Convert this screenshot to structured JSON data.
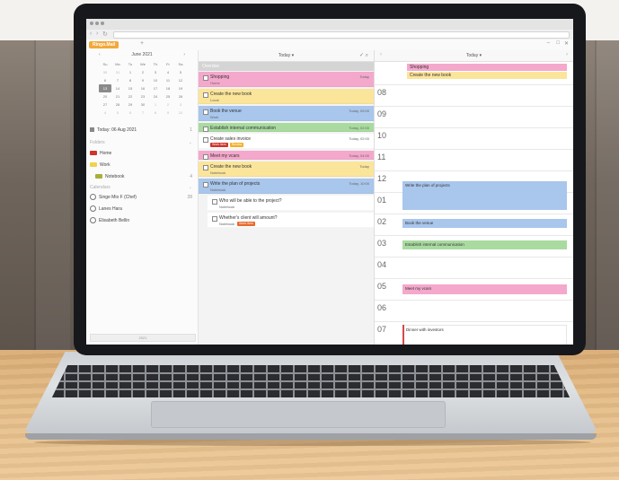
{
  "app": {
    "tab_label": "Ringo.Mail"
  },
  "mini_calendar": {
    "month": "June 2021",
    "weekdays": [
      "Su",
      "Mo",
      "Tu",
      "We",
      "Th",
      "Fr",
      "Sa"
    ],
    "weeks": [
      [
        "30",
        "31",
        "1",
        "2",
        "3",
        "4",
        "5"
      ],
      [
        "6",
        "7",
        "8",
        "9",
        "10",
        "11",
        "12"
      ],
      [
        "13",
        "14",
        "15",
        "16",
        "17",
        "18",
        "19"
      ],
      [
        "20",
        "21",
        "22",
        "23",
        "24",
        "25",
        "26"
      ],
      [
        "27",
        "28",
        "29",
        "30",
        "1",
        "2",
        "3"
      ],
      [
        "4",
        "5",
        "6",
        "7",
        "8",
        "9",
        "10"
      ]
    ]
  },
  "sidebar": {
    "today_label": "Today: 06 Aug 2021",
    "today_count": "1",
    "folders_heading": "Folders",
    "folders": [
      {
        "label": "Home",
        "color": "#d0342c"
      },
      {
        "label": "Work",
        "color": "#f2d24a"
      },
      {
        "label": "Notebook",
        "color": "#a8b03a",
        "count": "4"
      }
    ],
    "calendars_heading": "Calendars",
    "calendars": [
      {
        "label": "Singe Mio F (Chef)",
        "count": "28"
      },
      {
        "label": "Lanes Hara"
      },
      {
        "label": "Elisabeth Bellin"
      }
    ],
    "footer": "2021"
  },
  "tasks": {
    "header_title": "Today ▾",
    "section": "Overdue",
    "items": [
      {
        "title": "Shopping",
        "sub": "Home",
        "meta": "Today",
        "color": "#f4a8cc"
      },
      {
        "title": "Create the new book",
        "sub": "Local",
        "meta": "",
        "color": "#fbe59a"
      },
      {
        "title": "Book the venue",
        "sub": "Work",
        "meta": "Today, 09:00",
        "color": "#a9c6ec"
      },
      {
        "title": "Establish internal communication",
        "sub": "",
        "meta": "Today, 02:00",
        "color": "#a9dba0"
      },
      {
        "title": "Create sales invoice",
        "sub": "",
        "meta": "Today, 02:00",
        "color": "#ffffff",
        "tags": [
          [
            "Work item",
            "#d0342c"
          ],
          [
            "Review",
            "#f2b02a"
          ]
        ]
      },
      {
        "title": "Meet my vcars",
        "sub": "",
        "meta": "Today, 04:00",
        "color": "#f4a8cc"
      },
      {
        "title": "Create the new book",
        "sub": "Notebook",
        "meta": "Today",
        "color": "#fbe59a"
      },
      {
        "title": "Write the plan of projects",
        "sub": "Notebook",
        "meta": "Today, 10:00",
        "color": "#a9c6ec"
      },
      {
        "title": "Who will be able to the project?",
        "sub": "Notebook",
        "meta": "",
        "color": "#ffffff"
      },
      {
        "title": "Whether's client will amount?",
        "sub": "Notebook",
        "meta": "",
        "color": "#ffffff",
        "tags": [
          [
            "Work item",
            "#e86a2c"
          ]
        ]
      }
    ]
  },
  "day_view": {
    "header_title": "Today ▾",
    "allday": [
      {
        "label": "Shopping",
        "color": "#f4a8cc"
      },
      {
        "label": "Create the new book",
        "color": "#fbe59a"
      }
    ],
    "hours": [
      "08",
      "09",
      "10",
      "11",
      "12",
      "01",
      "02",
      "03",
      "04",
      "05",
      "06",
      "07"
    ],
    "events": [
      {
        "label": "Write the plan of projects",
        "color": "#a9c6ec"
      },
      {
        "label": "Book the venue",
        "color": "#a9c6ec"
      },
      {
        "label": "Establish internal communication",
        "color": "#a9dba0"
      },
      {
        "label": "Meet my vcars",
        "color": "#f4a8cc"
      },
      {
        "label": "Dinner with investors",
        "color": "#ffffff"
      }
    ]
  }
}
